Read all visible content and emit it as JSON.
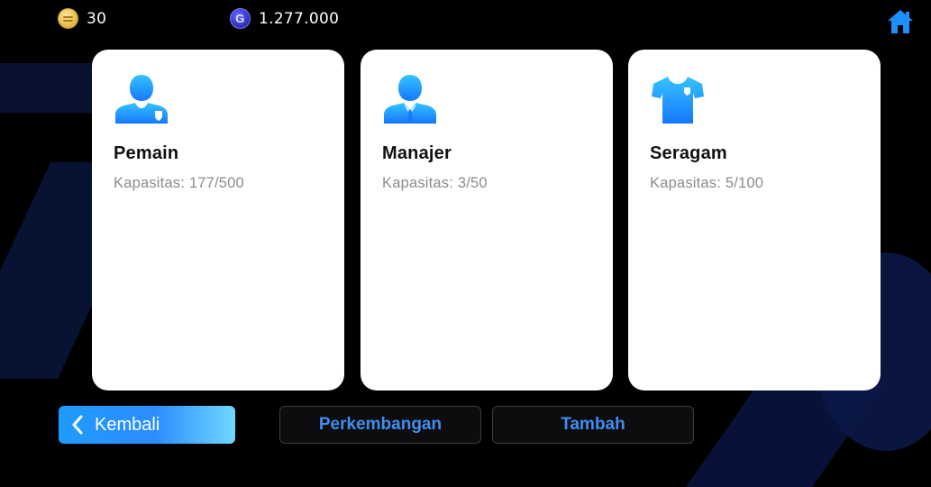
{
  "header": {
    "coins": "30",
    "gp": "1.277.000",
    "gp_icon_letter": "G",
    "coin_icon": "coin-icon",
    "gp_icon": "gp-icon",
    "home_icon": "home-icon"
  },
  "cards": [
    {
      "title": "Pemain",
      "capacity": "Kapasitas: 177/500",
      "icon": "player-icon"
    },
    {
      "title": "Manajer",
      "capacity": "Kapasitas: 3/50",
      "icon": "manager-icon"
    },
    {
      "title": "Seragam",
      "capacity": "Kapasitas: 5/100",
      "icon": "kit-icon"
    }
  ],
  "buttons": {
    "back_label": "Kembali",
    "develop_label": "Perkembangan",
    "add_label": "Tambah"
  },
  "colors": {
    "background": "#000000",
    "card": "#ffffff",
    "accent_blue": "#1e90ff",
    "outline_text": "#3d8ff0",
    "capacity_text": "#8c8c8c"
  }
}
